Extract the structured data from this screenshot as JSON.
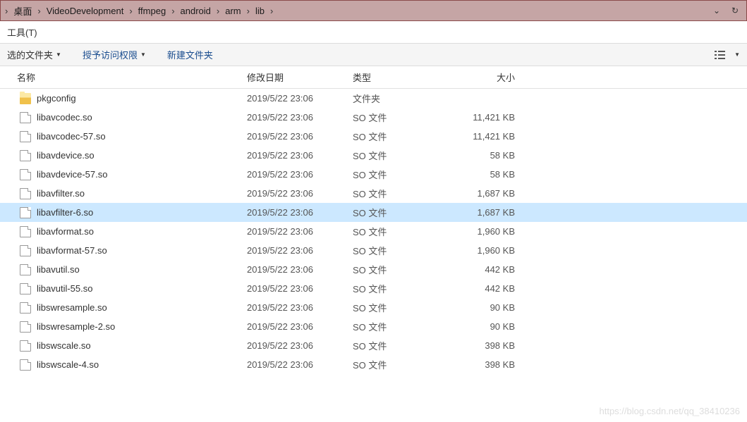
{
  "breadcrumb": [
    "桌面",
    "VideoDevelopment",
    "ffmpeg",
    "android",
    "arm",
    "lib"
  ],
  "menu": {
    "tools": "工具(T)"
  },
  "toolbar": {
    "selected_folder": "选的文件夹",
    "grant_access": "授予访问权限",
    "new_folder": "新建文件夹"
  },
  "columns": {
    "name": "名称",
    "date": "修改日期",
    "type": "类型",
    "size": "大小"
  },
  "files": [
    {
      "icon": "folder",
      "name": "pkgconfig",
      "date": "2019/5/22 23:06",
      "type": "文件夹",
      "size": "",
      "selected": false
    },
    {
      "icon": "file",
      "name": "libavcodec.so",
      "date": "2019/5/22 23:06",
      "type": "SO 文件",
      "size": "11,421 KB",
      "selected": false
    },
    {
      "icon": "file",
      "name": "libavcodec-57.so",
      "date": "2019/5/22 23:06",
      "type": "SO 文件",
      "size": "11,421 KB",
      "selected": false
    },
    {
      "icon": "file",
      "name": "libavdevice.so",
      "date": "2019/5/22 23:06",
      "type": "SO 文件",
      "size": "58 KB",
      "selected": false
    },
    {
      "icon": "file",
      "name": "libavdevice-57.so",
      "date": "2019/5/22 23:06",
      "type": "SO 文件",
      "size": "58 KB",
      "selected": false
    },
    {
      "icon": "file",
      "name": "libavfilter.so",
      "date": "2019/5/22 23:06",
      "type": "SO 文件",
      "size": "1,687 KB",
      "selected": false
    },
    {
      "icon": "file",
      "name": "libavfilter-6.so",
      "date": "2019/5/22 23:06",
      "type": "SO 文件",
      "size": "1,687 KB",
      "selected": true
    },
    {
      "icon": "file",
      "name": "libavformat.so",
      "date": "2019/5/22 23:06",
      "type": "SO 文件",
      "size": "1,960 KB",
      "selected": false
    },
    {
      "icon": "file",
      "name": "libavformat-57.so",
      "date": "2019/5/22 23:06",
      "type": "SO 文件",
      "size": "1,960 KB",
      "selected": false
    },
    {
      "icon": "file",
      "name": "libavutil.so",
      "date": "2019/5/22 23:06",
      "type": "SO 文件",
      "size": "442 KB",
      "selected": false
    },
    {
      "icon": "file",
      "name": "libavutil-55.so",
      "date": "2019/5/22 23:06",
      "type": "SO 文件",
      "size": "442 KB",
      "selected": false
    },
    {
      "icon": "file",
      "name": "libswresample.so",
      "date": "2019/5/22 23:06",
      "type": "SO 文件",
      "size": "90 KB",
      "selected": false
    },
    {
      "icon": "file",
      "name": "libswresample-2.so",
      "date": "2019/5/22 23:06",
      "type": "SO 文件",
      "size": "90 KB",
      "selected": false
    },
    {
      "icon": "file",
      "name": "libswscale.so",
      "date": "2019/5/22 23:06",
      "type": "SO 文件",
      "size": "398 KB",
      "selected": false
    },
    {
      "icon": "file",
      "name": "libswscale-4.so",
      "date": "2019/5/22 23:06",
      "type": "SO 文件",
      "size": "398 KB",
      "selected": false
    }
  ],
  "watermark": "https://blog.csdn.net/qq_38410236"
}
